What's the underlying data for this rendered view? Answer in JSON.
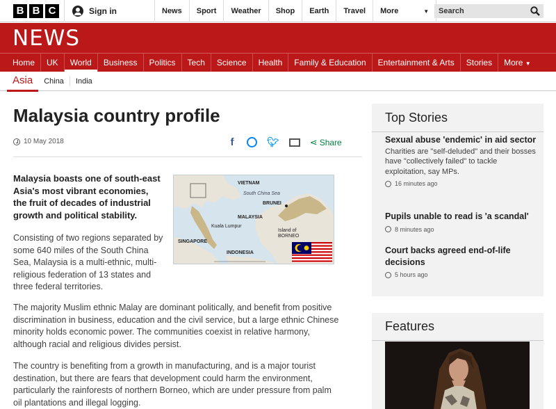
{
  "topbar": {
    "logo_letters": [
      "B",
      "B",
      "C"
    ],
    "sign_in": "Sign in",
    "links": [
      "News",
      "Sport",
      "Weather",
      "Shop",
      "Earth",
      "Travel"
    ],
    "more": "More",
    "search_placeholder": "Search"
  },
  "brand": {
    "name": "NEWS",
    "color": "#bb1919"
  },
  "section_nav": {
    "items": [
      "Home",
      "UK",
      "World",
      "Business",
      "Politics",
      "Tech",
      "Science",
      "Health",
      "Family & Education",
      "Entertainment & Arts",
      "Stories"
    ],
    "more": "More",
    "active": "World"
  },
  "sub_nav": {
    "current": "Asia",
    "items": [
      "China",
      "India"
    ]
  },
  "article": {
    "title": "Malaysia country profile",
    "date": "10 May 2018",
    "share_label": "Share",
    "lead": "Malaysia boasts one of south-east Asia's most vibrant economies, the fruit of decades of industrial growth and political stability.",
    "paragraphs": [
      "Consisting of two regions separated by some 640 miles of the South China Sea, Malaysia is a multi-ethnic, multi-religious federation of 13 states and three federal territories.",
      "The majority Muslim ethnic Malay are dominant politically, and benefit from positive discrimination in business, education and the civil service, but a large ethnic Chinese minority holds economic power. The communities coexist in relative harmony, although racial and religious divides persist.",
      "The country is benefiting from a growth in manufacturing, and is a major tourist destination, but there are fears that development could harm the environment, particularly the rainforests of northern Borneo, which are under pressure from palm oil plantations and illegal logging."
    ],
    "map_labels": {
      "vietnam": "VIETNAM",
      "sea": "South China Sea",
      "brunei": "BRUNEI",
      "malaysia": "MALAYSIA",
      "kl": "Kuala Lumpur",
      "borneo_1": "Island of",
      "borneo_2": "BORNEO",
      "singapore": "SINGAPORE",
      "indonesia": "INDONESIA"
    }
  },
  "top_stories": {
    "heading": "Top Stories",
    "items": [
      {
        "title": "Sexual abuse 'endemic' in aid sector",
        "summary": "Charities are \"self-deluded\" and their bosses have \"collectively failed\" to tackle exploitation, say MPs.",
        "time": "16 minutes ago"
      },
      {
        "title": "Pupils unable to read is 'a scandal'",
        "time": "8 minutes ago"
      },
      {
        "title": "Court backs agreed end-of-life decisions",
        "time": "5 hours ago"
      }
    ]
  },
  "features": {
    "heading": "Features"
  }
}
